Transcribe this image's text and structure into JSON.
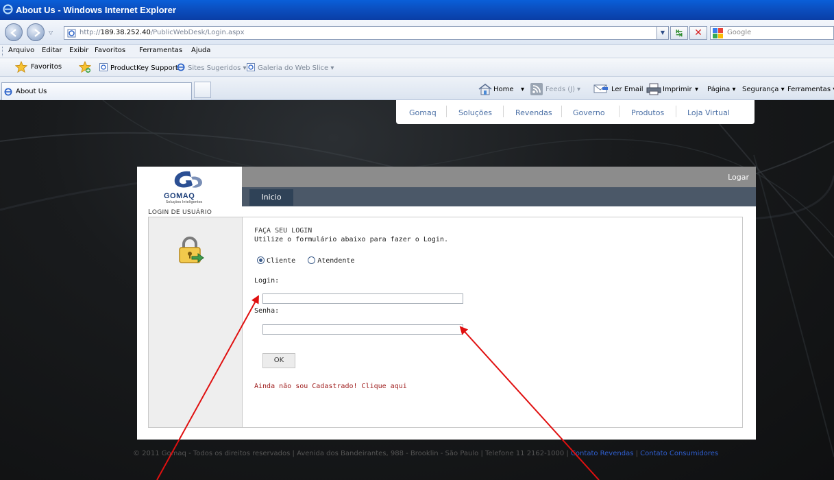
{
  "window": {
    "title": "About Us - Windows Internet Explorer"
  },
  "address_bar": {
    "url_prefix": "http://",
    "url_host": "189.38.252.40",
    "url_path": "/PublicWebDesk/Login.aspx",
    "search_placeholder": "Google"
  },
  "menu": [
    "Arquivo",
    "Editar",
    "Exibir",
    "Favoritos",
    "Ferramentas",
    "Ajuda"
  ],
  "favorites_bar": {
    "favorites_label": "Favoritos",
    "items": [
      "ProductKey Support",
      "Sites Sugeridos ▾",
      "Galeria do Web Slice ▾"
    ]
  },
  "tab": {
    "label": "About Us"
  },
  "commands": {
    "home": "Home",
    "feeds": "Feeds (J)",
    "read_mail": "Ler Email",
    "print": "Imprimir",
    "page": "Página ▾",
    "security": "Segurança ▾",
    "tools": "Ferramentas ▾"
  },
  "site_nav": [
    "Gomaq",
    "Soluções",
    "Revendas",
    "Governo",
    "Produtos",
    "Loja Virtual"
  ],
  "card": {
    "logo_text": "GOMAQ",
    "logo_sub": "Soluções Inteligentes",
    "header_action": "Logar",
    "tab_inicio": "Inicio",
    "section_label_cap": "L",
    "section_label_rest": "OGIN DE USUÁRIO"
  },
  "form": {
    "title": "FAÇA SEU LOGIN",
    "description": "Utilize o formulário abaixo para fazer o Login.",
    "radio_options": [
      {
        "label": "Cliente",
        "selected": true
      },
      {
        "label": "Atendente",
        "selected": false
      }
    ],
    "login_label": "Login:",
    "login_value": "",
    "password_label": "Senha:",
    "password_value": "",
    "ok_label": "OK",
    "register_link": "Ainda não sou Cadastrado! Clique aqui"
  },
  "footer": {
    "text": "© 2011 Gomaq - Todos os direitos reservados | Avenida dos Bandeirantes, 988 - Brooklin - São Paulo | Telefone 11 2162-1000 |",
    "link_resellers": "Contato Revendas",
    "sep": "|",
    "link_consumers": "Contato Consumidores"
  },
  "colors": {
    "titlebar": "#0b4fc0",
    "page_background": "#1a1c1e",
    "annotation_arrow": "#e01010",
    "register_link": "#9e1b1b",
    "footer_link": "#2f5fd0",
    "tab_active": "#2f4257"
  }
}
